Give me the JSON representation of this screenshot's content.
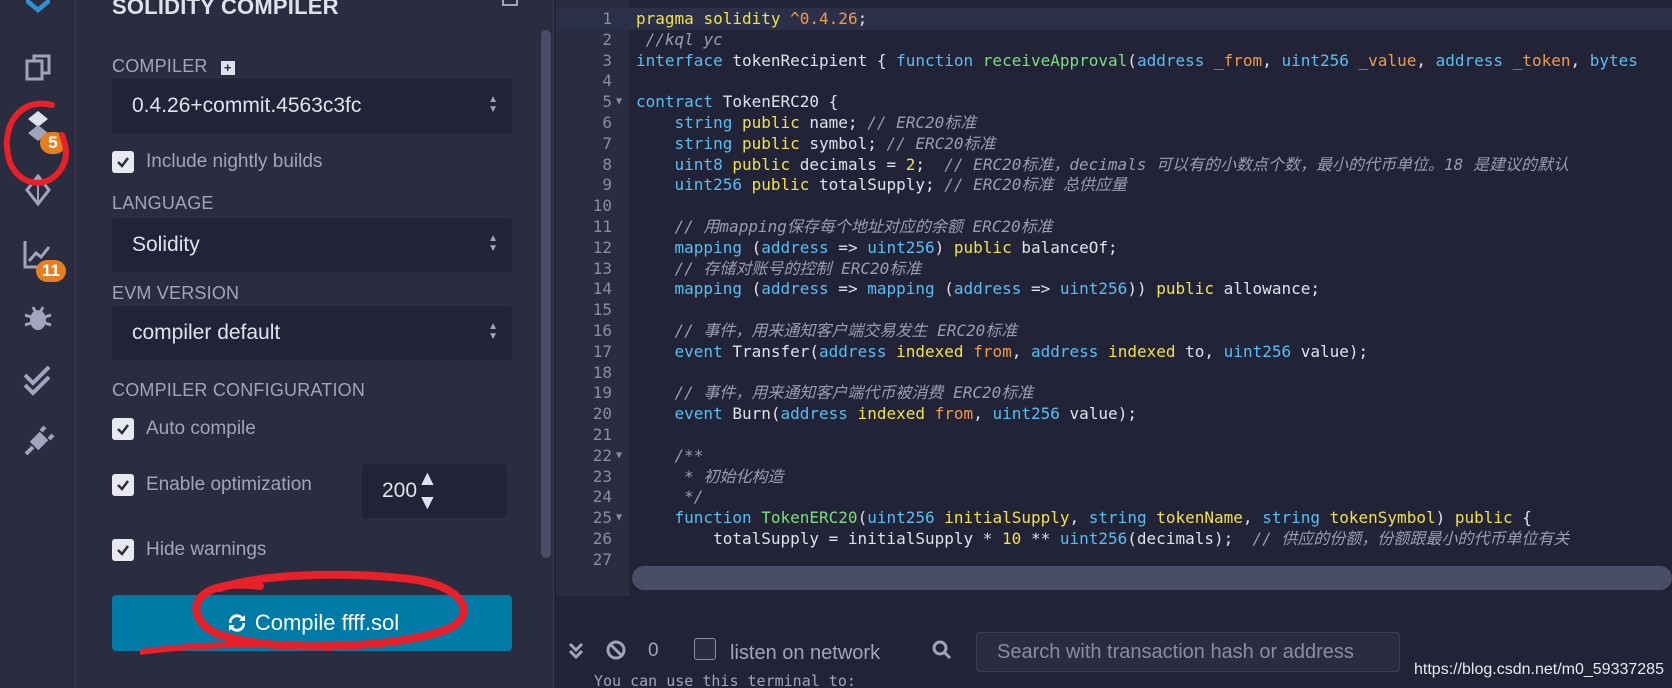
{
  "rail": {
    "badges": {
      "compiler": "5",
      "analysis": "11"
    }
  },
  "panel": {
    "title": "SOLIDITY COMPILER",
    "compiler_label": "COMPILER",
    "compiler_version": "0.4.26+commit.4563c3fc",
    "include_nightly": "Include nightly builds",
    "language_label": "LANGUAGE",
    "language_value": "Solidity",
    "evm_label": "EVM VERSION",
    "evm_value": "compiler default",
    "config_label": "COMPILER CONFIGURATION",
    "auto_compile": "Auto compile",
    "enable_optimization": "Enable optimization",
    "optimization_runs": "200",
    "hide_warnings": "Hide warnings",
    "compile_button": "Compile ffff.sol"
  },
  "editor": {
    "line_numbers": [
      "1",
      "2",
      "3",
      "4",
      "5",
      "6",
      "7",
      "8",
      "9",
      "10",
      "11",
      "12",
      "13",
      "14",
      "15",
      "16",
      "17",
      "18",
      "19",
      "20",
      "21",
      "22",
      "23",
      "24",
      "25",
      "26",
      "27"
    ]
  },
  "terminal": {
    "count": "0",
    "listen_label": "listen on network",
    "search_placeholder": "Search with transaction hash or address",
    "hint": "You can use this terminal to:"
  },
  "watermark": "https://blog.csdn.net/m0_59337285",
  "colors": {
    "accent": "#007aa6",
    "badge": "#e67e22",
    "annotation": "#e8202a"
  }
}
